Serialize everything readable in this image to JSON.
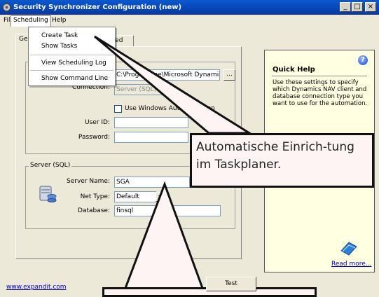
{
  "window": {
    "title": "Security Synchronizer Configuration (new)",
    "minimize_glyph": "_",
    "maximize_glyph": "□",
    "close_glyph": "×"
  },
  "menu": {
    "file": "File",
    "scheduling": "Scheduling",
    "help": "Help"
  },
  "scheduling_menu": {
    "items": [
      "Create Task",
      "Show Tasks",
      "View Scheduling Log",
      "Show Command Line"
    ]
  },
  "tabs": {
    "general": "Ge",
    "advanced": "anced"
  },
  "nav_client": {
    "path_value": "C:\\Programme\\Microsoft Dynamics",
    "browse_label": "...",
    "connection_label": "Connection:",
    "connection_value": "Server (SQL)",
    "windows_auth_label": "Use Windows Authentication",
    "user_id_label": "User ID:",
    "user_id_value": "",
    "password_label": "Password:",
    "password_value": ""
  },
  "server_sql": {
    "group_label": "Server (SQL)",
    "server_name_label": "Server Name:",
    "server_name_value": "SGA",
    "net_type_label": "Net Type:",
    "net_type_value": "Default",
    "database_label": "Database:",
    "database_value": "finsql"
  },
  "footer": {
    "link": "www.expandit.com",
    "test_label": "Test"
  },
  "quick_help": {
    "title": "Quick Help",
    "body": "Use these settings to specify which Dynamics NAV client and database connection type you want to use for the automation.",
    "read_more": "Read more...",
    "help_glyph": "?"
  },
  "callout": {
    "text": "Automatische Einrich-tung im Taskplaner."
  }
}
